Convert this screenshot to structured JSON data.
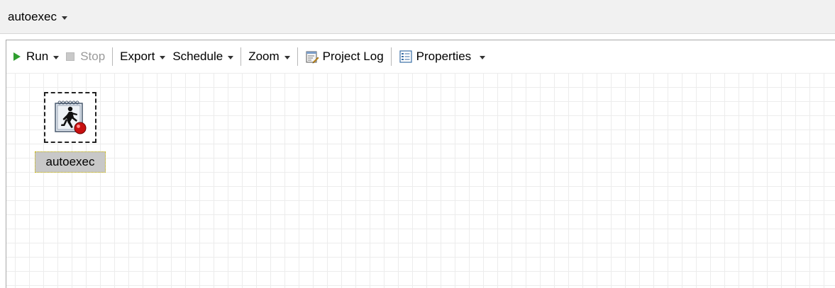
{
  "window": {
    "title": "autoexec"
  },
  "toolbar": {
    "run_label": "Run",
    "stop_label": "Stop",
    "export_label": "Export",
    "schedule_label": "Schedule",
    "zoom_label": "Zoom",
    "project_log_label": "Project Log",
    "properties_label": "Properties"
  },
  "canvas": {
    "nodes": [
      {
        "label": "autoexec",
        "icon": "running-man-program-icon"
      }
    ]
  },
  "colors": {
    "run_green": "#2f9e2f",
    "disabled_gray": "#9a9a9a",
    "selection_label_bg": "#c8c8c8"
  }
}
